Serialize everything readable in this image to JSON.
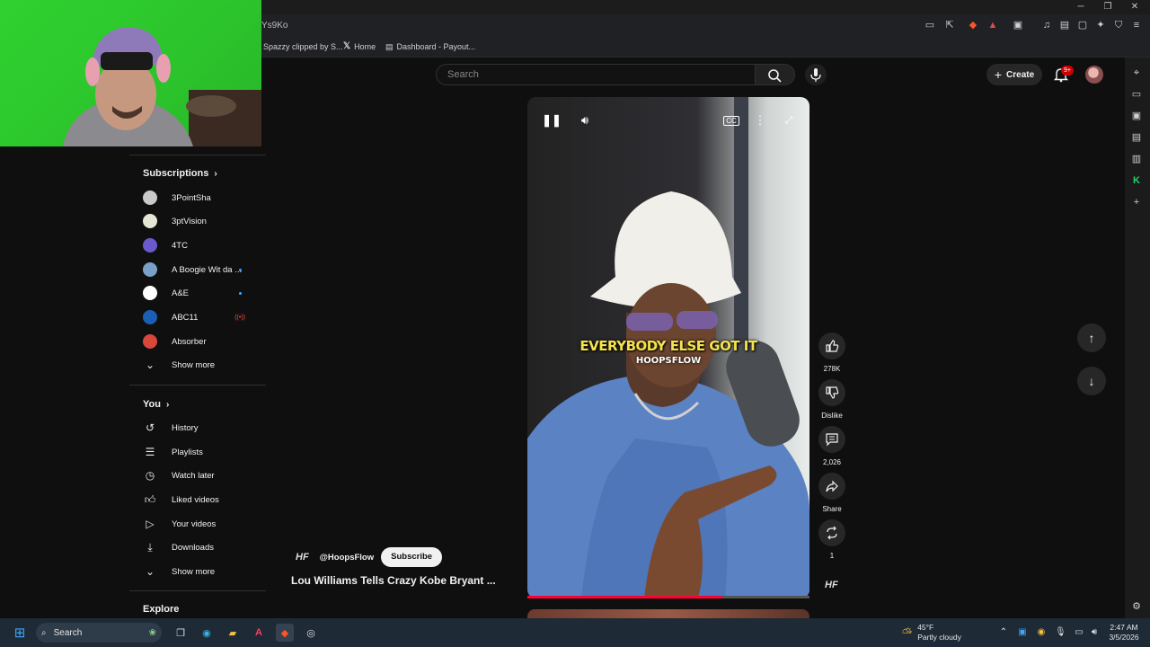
{
  "browser": {
    "url_fragment": "Ys9Ko",
    "bookmarks": [
      {
        "label": "Spazzy clipped by S..."
      },
      {
        "label": "Home"
      },
      {
        "label": "Dashboard - Payout..."
      }
    ],
    "window_controls": {
      "minimize": "─",
      "restore": "❐",
      "close": "✕"
    }
  },
  "youtube": {
    "search": {
      "placeholder": "Search"
    },
    "create_label": "Create",
    "notif_count": "9+",
    "sidebar": {
      "subscriptions_heading": "Subscriptions",
      "subscriptions": [
        {
          "label": "3PointSha",
          "color": "#c9c9c9",
          "indicator": ""
        },
        {
          "label": "3ptVision",
          "color": "#e6e6d5",
          "indicator": ""
        },
        {
          "label": "4TC",
          "color": "#6a5acd",
          "indicator": ""
        },
        {
          "label": "A Boogie Wit da ...",
          "color": "#7aa0c8",
          "indicator": "dot"
        },
        {
          "label": "A&E",
          "color": "#ffffff",
          "indicator": "dot"
        },
        {
          "label": "ABC11",
          "color": "#1a5fb4",
          "indicator": "live"
        },
        {
          "label": "Absorber",
          "color": "#d9473a",
          "indicator": ""
        }
      ],
      "show_more": "Show more",
      "you_heading": "You",
      "you_items": [
        {
          "label": "History",
          "icon": "history-icon"
        },
        {
          "label": "Playlists",
          "icon": "playlists-icon"
        },
        {
          "label": "Watch later",
          "icon": "watch-later-icon"
        },
        {
          "label": "Liked videos",
          "icon": "liked-videos-icon"
        },
        {
          "label": "Your videos",
          "icon": "your-videos-icon"
        },
        {
          "label": "Downloads",
          "icon": "downloads-icon"
        }
      ],
      "show_more_2": "Show more",
      "explore_heading": "Explore"
    },
    "short": {
      "caption_line1": "EVERYBODY ELSE GOT IT",
      "caption_line2": "HOOPSFLOW",
      "channel": "@HoopsFlow",
      "subscribe_label": "Subscribe",
      "title": "Lou Williams Tells Crazy Kobe Bryant ...",
      "progress": 0.69,
      "actions": {
        "likes": "278K",
        "dislike": "Dislike",
        "comments": "2,026",
        "share": "Share",
        "remix": "1"
      }
    }
  },
  "taskbar": {
    "search_label": "Search",
    "weather_temp": "45°F",
    "weather_desc": "Partly cloudy",
    "time": "2:47 AM",
    "date": "3/5/2026"
  }
}
